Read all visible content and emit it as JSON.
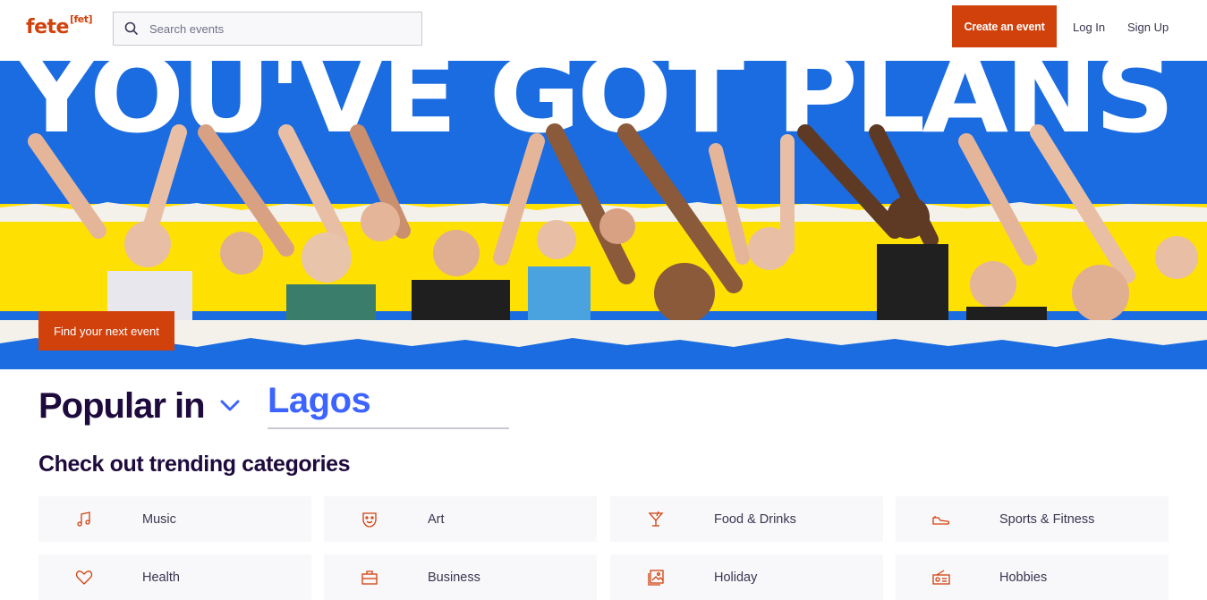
{
  "header": {
    "logo_main": "fete",
    "logo_sup": "[fet]",
    "search_placeholder": "Search events",
    "create_label": "Create an event",
    "login_label": "Log In",
    "signup_label": "Sign Up"
  },
  "hero": {
    "headline": "YOU'VE GOT PLANS",
    "cta_label": "Find your next event"
  },
  "popular": {
    "label": "Popular in",
    "city": "Lagos"
  },
  "trending": {
    "title": "Check out trending categories",
    "categories": [
      {
        "label": "Music",
        "icon": "music-note-icon"
      },
      {
        "label": "Art",
        "icon": "theater-mask-icon"
      },
      {
        "label": "Food & Drinks",
        "icon": "cocktail-icon"
      },
      {
        "label": "Sports & Fitness",
        "icon": "sneaker-icon"
      },
      {
        "label": "Health",
        "icon": "heart-icon"
      },
      {
        "label": "Business",
        "icon": "briefcase-icon"
      },
      {
        "label": "Holiday",
        "icon": "photo-icon"
      },
      {
        "label": "Hobbies",
        "icon": "radio-icon"
      }
    ]
  },
  "colors": {
    "brand": "#d1410c",
    "hero_blue": "#1b6ce0",
    "hero_yellow": "#ffe003",
    "city_blue": "#3d64ff"
  }
}
